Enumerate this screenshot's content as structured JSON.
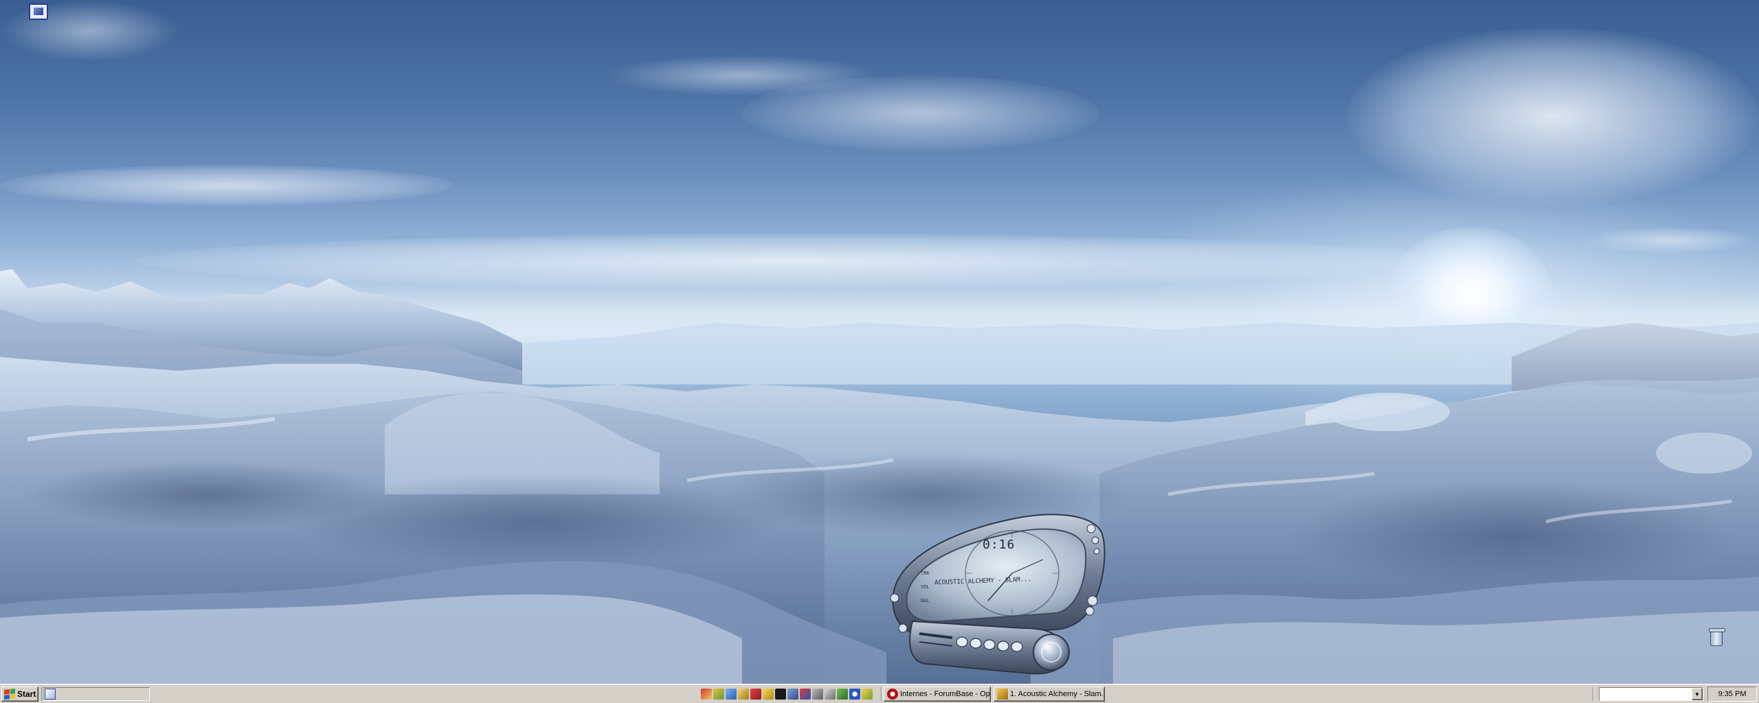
{
  "desktop": {
    "icons": [
      {
        "name": "top-left-shortcut",
        "label": ""
      },
      {
        "name": "recycle-bin",
        "label": ""
      }
    ]
  },
  "media_player": {
    "time_display": "0:16",
    "track_title": "ACOUSTIC ALCHEMY - SLAM..."
  },
  "taskbar": {
    "start_label": "Start",
    "quick_launch": [
      "show-desktop-icon"
    ],
    "tray_icons": [
      "pen-icon",
      "flag-icon",
      "window-icon",
      "key-icon",
      "monitor-icon",
      "search-icon",
      "black-icon",
      "network-icon",
      "flag-icon",
      "globe-icon",
      "speaker-icon",
      "printer-icon",
      "info-icon",
      "pen-icon"
    ],
    "buttons": [
      {
        "label": "Internes - ForumBase - Op...",
        "icon": "opera-icon"
      },
      {
        "label": "1. Acoustic Alchemy - Slam...",
        "icon": "winamp-icon"
      }
    ],
    "address_value": "",
    "clock": "9:35 PM"
  },
  "colors": {
    "taskbar": "#d4d0c8",
    "sky_top": "#3a5e92",
    "snow_light": "#dfe9f5"
  }
}
